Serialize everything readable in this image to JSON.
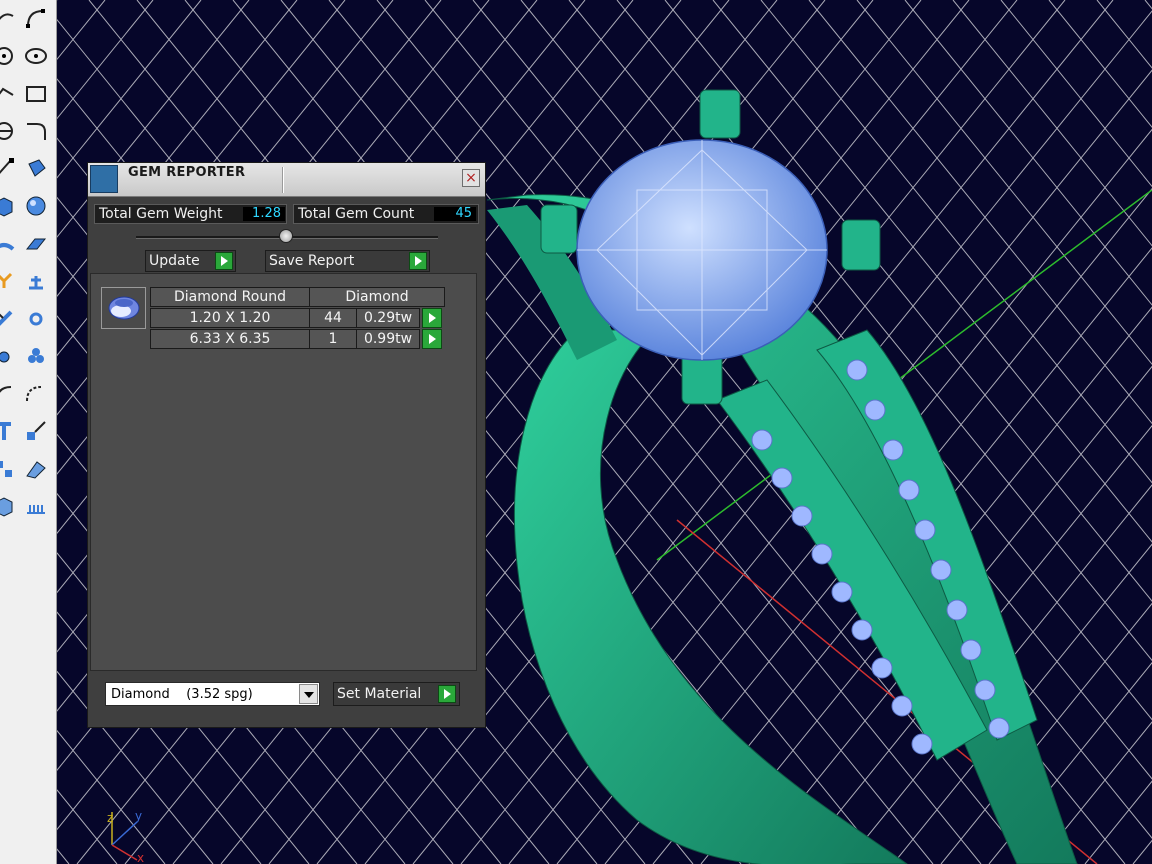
{
  "gem_reporter": {
    "title": "GEM REPORTER",
    "close_symbol": "×",
    "total_weight_label": "Total Gem Weight",
    "total_weight_value": "1.28",
    "total_count_label": "Total Gem Count",
    "total_count_value": "45",
    "update_label": "Update",
    "save_report_label": "Save Report",
    "table_headers": [
      "Diamond Round",
      "Diamond"
    ],
    "rows": [
      {
        "size": "1.20 X 1.20",
        "count": "44",
        "weight": "0.29tw"
      },
      {
        "size": "6.33 X 6.35",
        "count": "1",
        "weight": "0.99tw"
      }
    ],
    "material_value": "Diamond    (3.52 spg)",
    "set_material_label": "Set Material"
  },
  "viewport": {
    "axis_labels": {
      "z": "z",
      "y": "y",
      "x": "x"
    },
    "colors": {
      "background": "#06062a",
      "grid": "#c8c8d0",
      "ring": "#1fae86",
      "gem": "#8fb6ff",
      "green_axis": "#2dbb2d",
      "red_axis": "#d03030"
    }
  },
  "toolbar": {
    "icons": [
      "curve-icon",
      "arc-icon",
      "circle-icon",
      "ellipse-icon",
      "polyline-icon",
      "rectangle-icon",
      "point-icon",
      "fillet-icon",
      "line-icon",
      "revolve-icon",
      "box-icon",
      "sphere-icon",
      "surface-icon",
      "patch-icon",
      "explode-icon",
      "gumball-icon",
      "trim-icon",
      "split-icon",
      "join-icon",
      "dots-icon",
      "move-icon",
      "scale-icon",
      "text-icon",
      "array-icon",
      "group-icon",
      "layer-icon",
      "cube-icon",
      "measure-icon"
    ]
  }
}
